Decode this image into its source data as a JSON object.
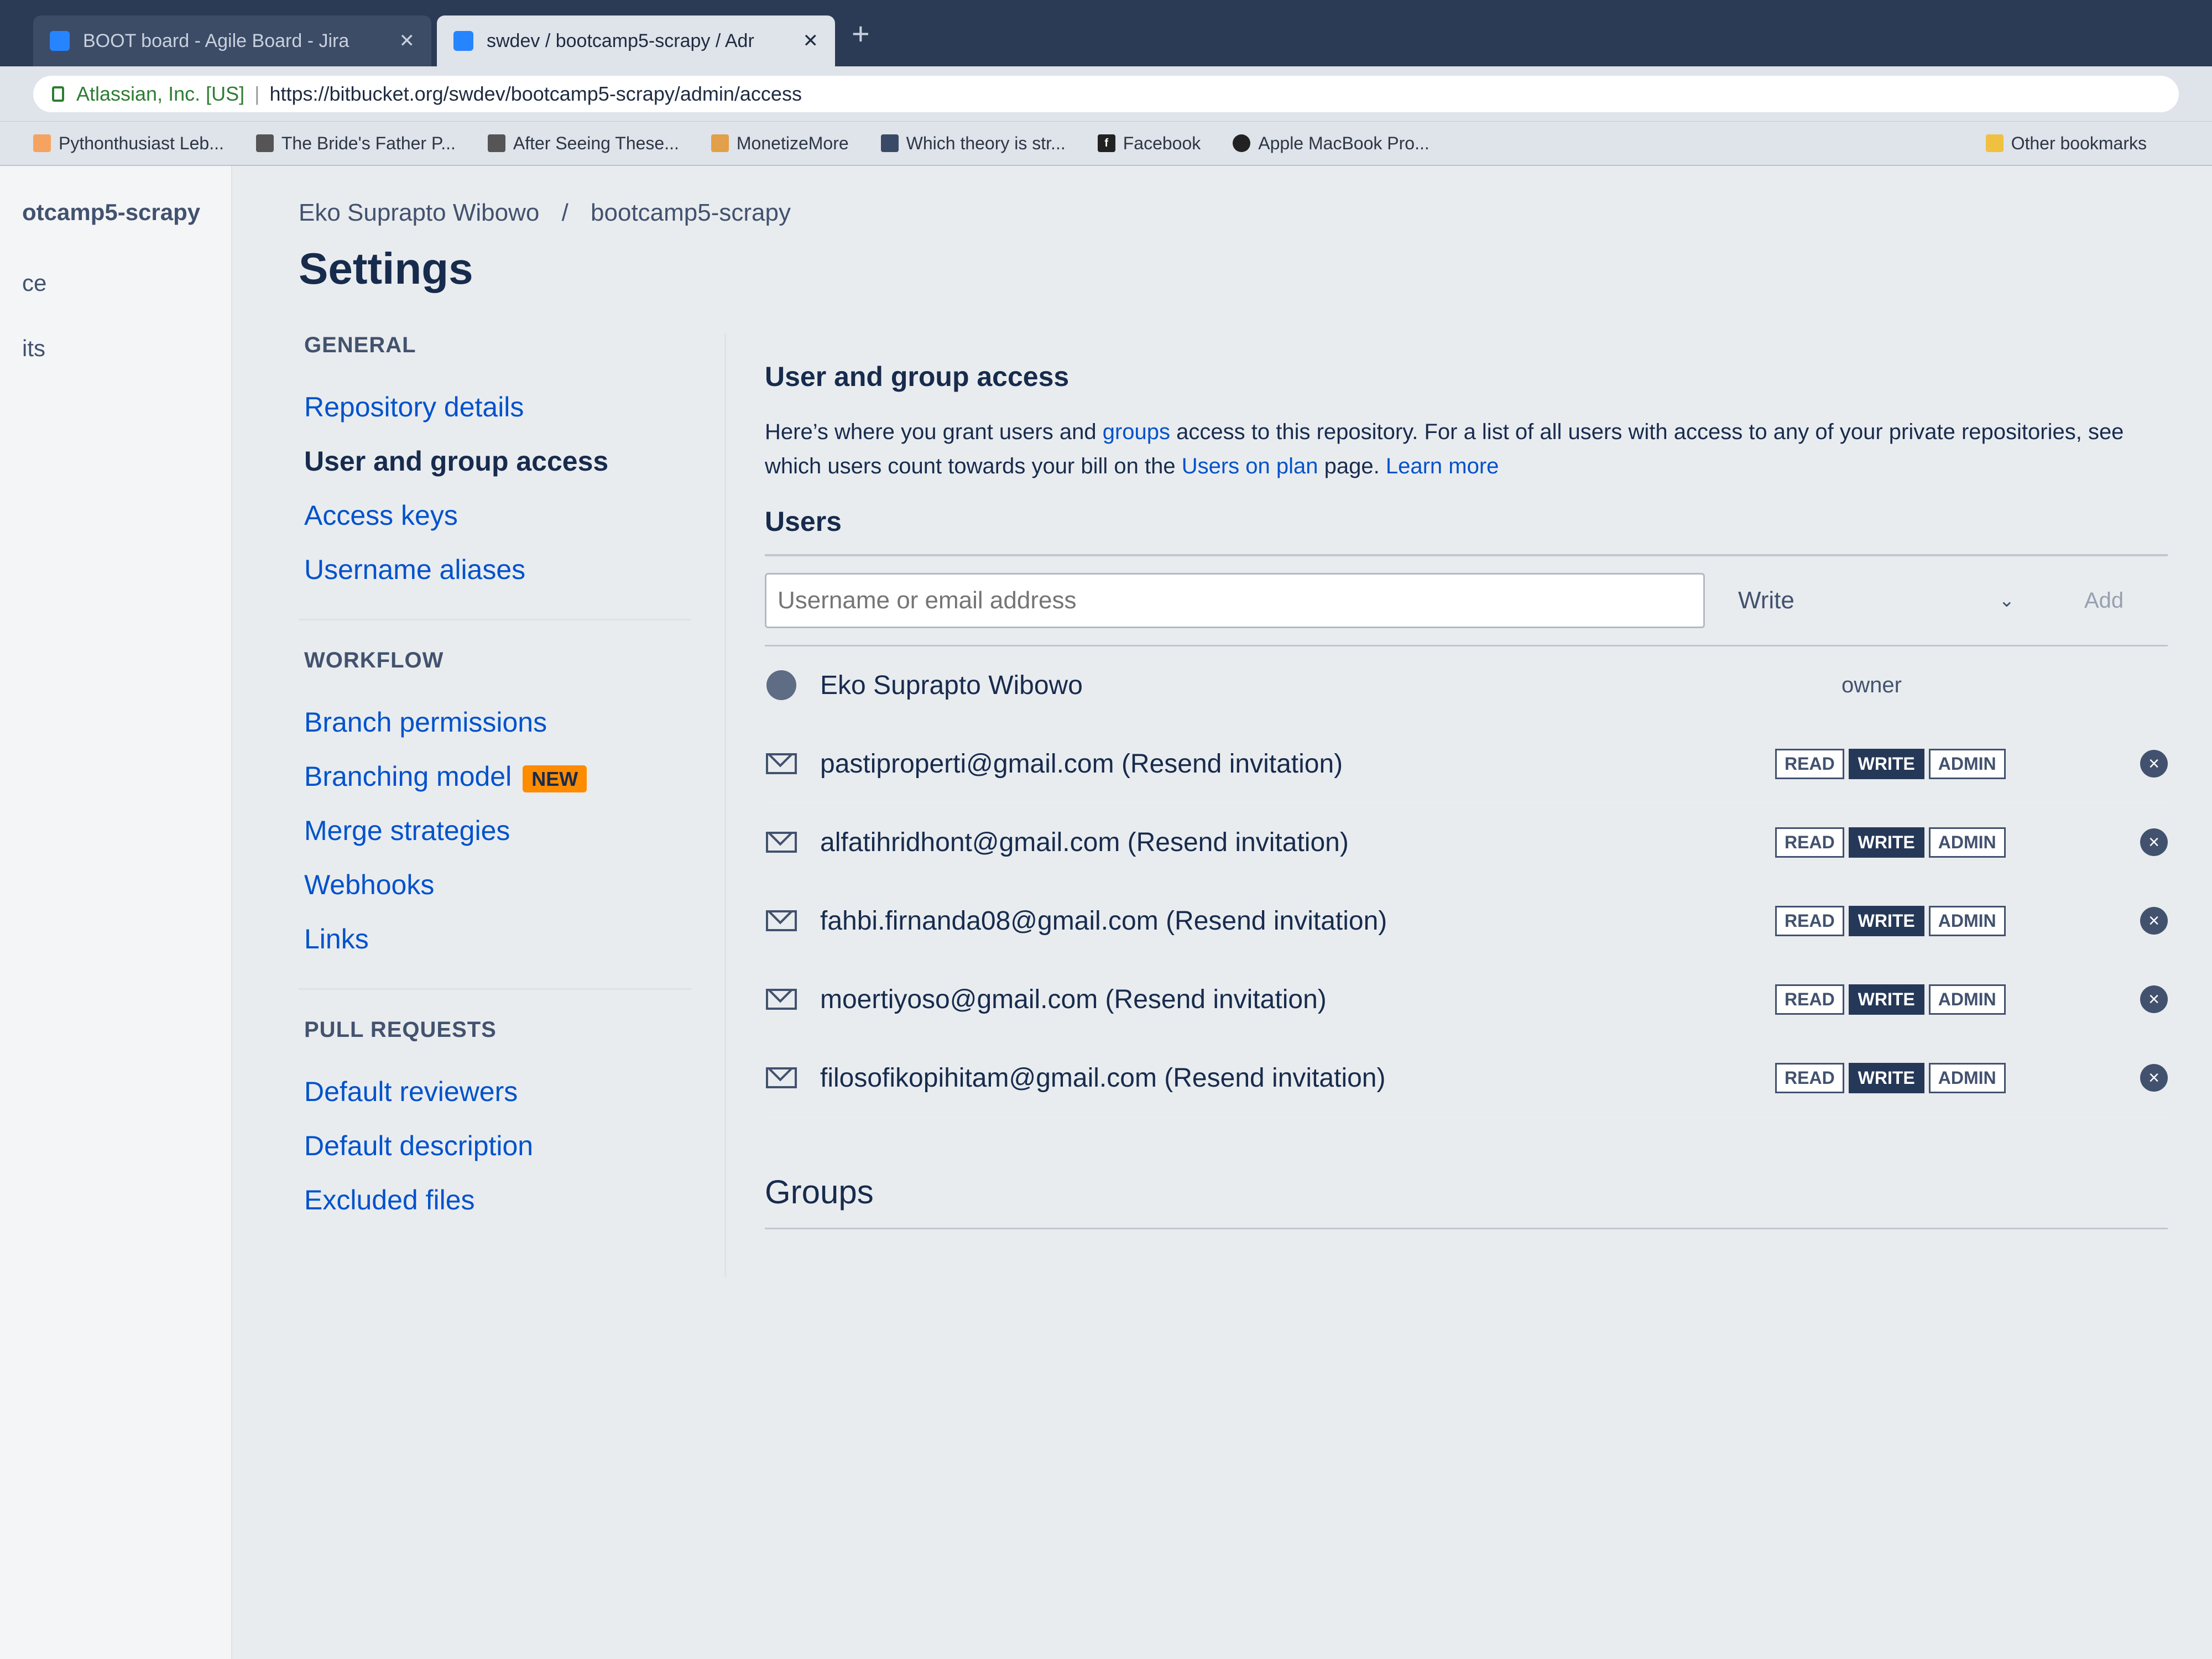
{
  "browser": {
    "tabs": [
      {
        "title": "BOOT board - Agile Board - Jira",
        "active": false
      },
      {
        "title": "swdev / bootcamp5-scrapy / Adr",
        "active": true
      }
    ],
    "address": {
      "org": "Atlassian, Inc. [US]",
      "separator": "|",
      "url": "https://bitbucket.org/swdev/bootcamp5-scrapy/admin/access"
    },
    "bookmarks": [
      "Pythonthusiast Leb...",
      "The Bride's Father P...",
      "After Seeing These...",
      "MonetizeMore",
      "Which theory is str...",
      "Facebook",
      "Apple MacBook Pro..."
    ],
    "other_bookmarks": "Other bookmarks"
  },
  "repo_sidebar": {
    "repo_name": "otcamp5-scrapy",
    "links": [
      "ce",
      "its"
    ]
  },
  "breadcrumb": {
    "owner": "Eko Suprapto Wibowo",
    "separator": "/",
    "repo": "bootcamp5-scrapy"
  },
  "page_title": "Settings",
  "nav": {
    "general": {
      "heading": "GENERAL",
      "items": [
        "Repository details",
        "User and group access",
        "Access keys",
        "Username aliases"
      ]
    },
    "workflow": {
      "heading": "WORKFLOW",
      "items": [
        "Branch permissions",
        "Branching model",
        "Merge strategies",
        "Webhooks",
        "Links"
      ],
      "new_badge": "NEW"
    },
    "pull_requests": {
      "heading": "PULL REQUESTS",
      "items": [
        "Default reviewers",
        "Default description",
        "Excluded files"
      ]
    }
  },
  "main": {
    "title": "User and group access",
    "intro": {
      "part1": "Here’s where you grant users and ",
      "groups_link": "groups",
      "part2": " access to this repository. For a list of all users with access to any of your private repositories, see which users count towards your bill on the ",
      "users_link": "Users on plan",
      "part3": " page. ",
      "learn_more": "Learn more"
    },
    "users_heading": "Users",
    "add": {
      "placeholder": "Username or email address",
      "permission": "Write",
      "add_label": "Add"
    },
    "owner_row": {
      "name": "Eko Suprapto Wibowo",
      "role": "owner"
    },
    "permission_labels": {
      "read": "READ",
      "write": "WRITE",
      "admin": "ADMIN"
    },
    "invited_users": [
      {
        "email": "pastiproperti@gmail.com",
        "note": "(Resend invitation)",
        "permission": "WRITE"
      },
      {
        "email": "alfatihridhont@gmail.com",
        "note": "(Resend invitation)",
        "permission": "WRITE"
      },
      {
        "email": "fahbi.firnanda08@gmail.com",
        "note": "(Resend invitation)",
        "permission": "WRITE"
      },
      {
        "email": "moertiyoso@gmail.com",
        "note": "(Resend invitation)",
        "permission": "WRITE"
      },
      {
        "email": "filosofikopihitam@gmail.com",
        "note": "(Resend invitation)",
        "permission": "WRITE"
      }
    ],
    "groups_heading": "Groups"
  }
}
